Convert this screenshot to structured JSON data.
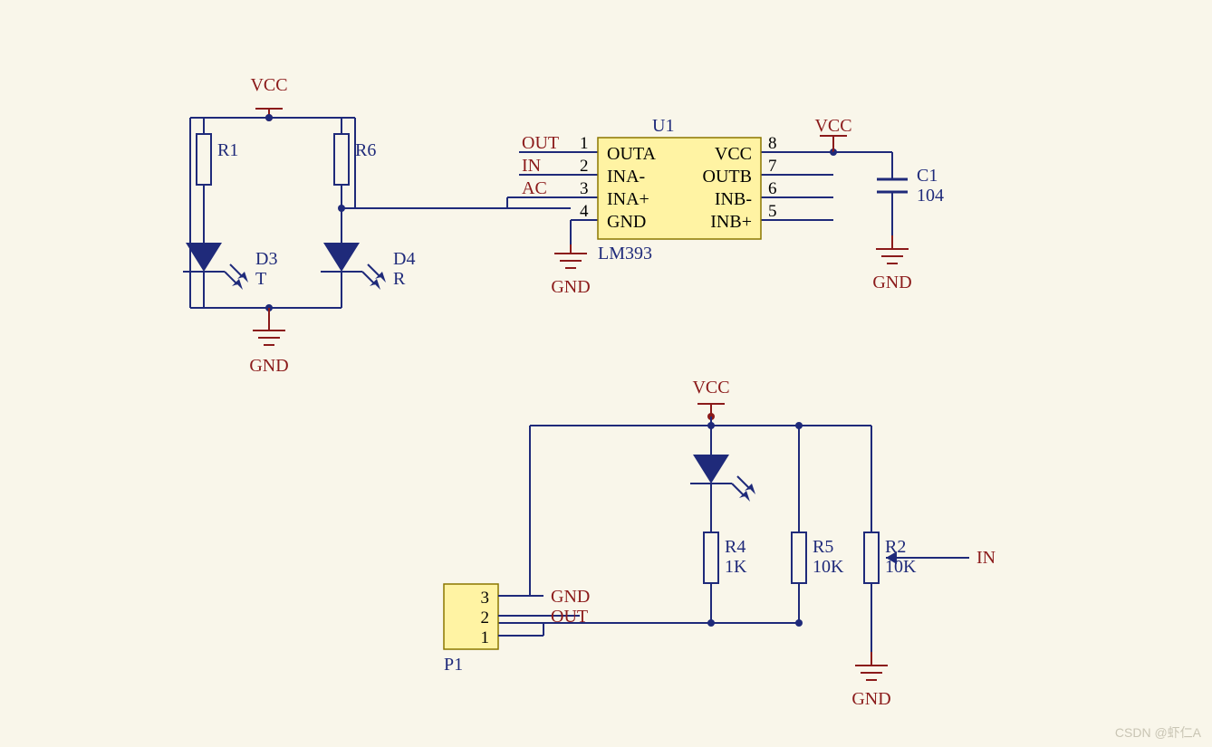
{
  "power": {
    "vcc": "VCC",
    "gnd": "GND"
  },
  "top_left": {
    "R1": "R1",
    "R6": "R6",
    "D3": {
      "ref": "D3",
      "val": "T"
    },
    "D4": {
      "ref": "D4",
      "val": "R"
    }
  },
  "U1": {
    "ref": "U1",
    "part": "LM393",
    "pins_left": {
      "1": "OUTA",
      "2": "INA-",
      "3": "INA+",
      "4": "GND"
    },
    "pins_right": {
      "8": "VCC",
      "7": "OUTB",
      "6": "INB-",
      "5": "INB+"
    },
    "nets_left": {
      "1": "OUT",
      "2": "IN",
      "3": "AC"
    }
  },
  "C1": {
    "ref": "C1",
    "val": "104"
  },
  "bottom": {
    "R4": {
      "ref": "R4",
      "val": "1K"
    },
    "R5": {
      "ref": "R5",
      "val": "10K"
    },
    "R2": {
      "ref": "R2",
      "val": "10K"
    },
    "P1": {
      "ref": "P1",
      "pins": {
        "3": "3",
        "2": "2",
        "1": "1"
      },
      "nets": {
        "3": "GND",
        "2": "OUT"
      }
    },
    "IN": "IN"
  },
  "watermark": "CSDN @虾仁A"
}
